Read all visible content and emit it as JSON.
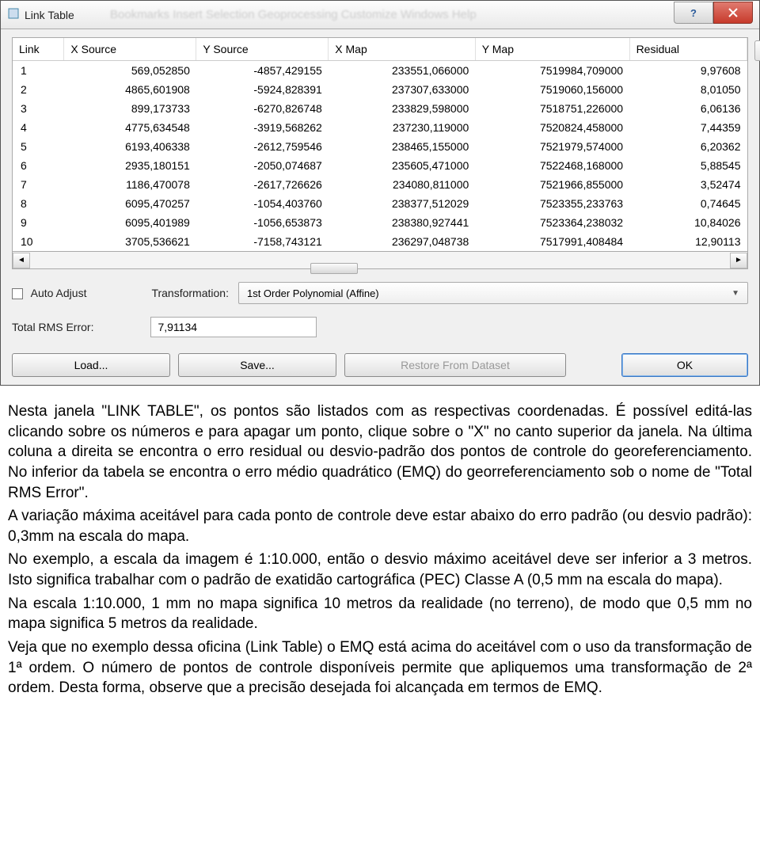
{
  "window": {
    "title": "Link Table",
    "behind": "Bookmarks   Insert   Selection   Geoprocessing   Customize   Windows   Help"
  },
  "table": {
    "headers": [
      "Link",
      "X Source",
      "Y Source",
      "X Map",
      "Y Map",
      "Residual"
    ],
    "rows": [
      [
        "1",
        "569,052850",
        "-4857,429155",
        "233551,066000",
        "7519984,709000",
        "9,97608"
      ],
      [
        "2",
        "4865,601908",
        "-5924,828391",
        "237307,633000",
        "7519060,156000",
        "8,01050"
      ],
      [
        "3",
        "899,173733",
        "-6270,826748",
        "233829,598000",
        "7518751,226000",
        "6,06136"
      ],
      [
        "4",
        "4775,634548",
        "-3919,568262",
        "237230,119000",
        "7520824,458000",
        "7,44359"
      ],
      [
        "5",
        "6193,406338",
        "-2612,759546",
        "238465,155000",
        "7521979,574000",
        "6,20362"
      ],
      [
        "6",
        "2935,180151",
        "-2050,074687",
        "235605,471000",
        "7522468,168000",
        "5,88545"
      ],
      [
        "7",
        "1186,470078",
        "-2617,726626",
        "234080,811000",
        "7521966,855000",
        "3,52474"
      ],
      [
        "8",
        "6095,470257",
        "-1054,403760",
        "238377,512029",
        "7523355,233763",
        "0,74645"
      ],
      [
        "9",
        "6095,401989",
        "-1056,653873",
        "238380,927441",
        "7523364,238032",
        "10,84026"
      ],
      [
        "10",
        "3705,536621",
        "-7158,743121",
        "236297,048738",
        "7517991,408484",
        "12,90113"
      ]
    ]
  },
  "controls": {
    "auto_adjust": "Auto Adjust",
    "transformation_label": "Transformation:",
    "transformation_value": "1st Order Polynomial (Affine)",
    "rms_label": "Total RMS Error:",
    "rms_value": "7,91134",
    "load": "Load...",
    "save": "Save...",
    "restore": "Restore From Dataset",
    "ok": "OK"
  },
  "prose": {
    "p1": "Nesta janela \"LINK TABLE\", os pontos são listados com as respectivas coordenadas. É possível editá-las clicando sobre os números e para apagar um ponto, clique sobre o \"X\" no canto superior da janela. Na última coluna a direita se encontra o erro residual ou desvio-padrão dos pontos de controle do georeferenciamento. No inferior da tabela se encontra o erro médio quadrático (EMQ) do georreferenciamento sob o nome de \"Total RMS Error\".",
    "p2": "A variação máxima aceitável para cada ponto de controle deve estar abaixo do erro padrão (ou desvio padrão): 0,3mm na escala do mapa.",
    "p3": "No exemplo, a escala da imagem é 1:10.000, então o desvio máximo aceitável deve ser inferior a 3 metros. Isto significa trabalhar com o padrão de exatidão cartográfica (PEC) Classe A (0,5 mm na escala do mapa).",
    "p4": "Na escala 1:10.000, 1 mm no mapa significa 10 metros da realidade (no terreno), de modo que 0,5 mm no mapa significa 5 metros da realidade.",
    "p5": "Veja que no exemplo dessa oficina (Link Table) o EMQ está acima do aceitável com o uso da transformação de 1ª ordem. O número de pontos de controle disponíveis permite que apliquemos uma transformação de 2ª ordem.  Desta forma, observe que a precisão desejada foi alcançada em termos de EMQ."
  }
}
